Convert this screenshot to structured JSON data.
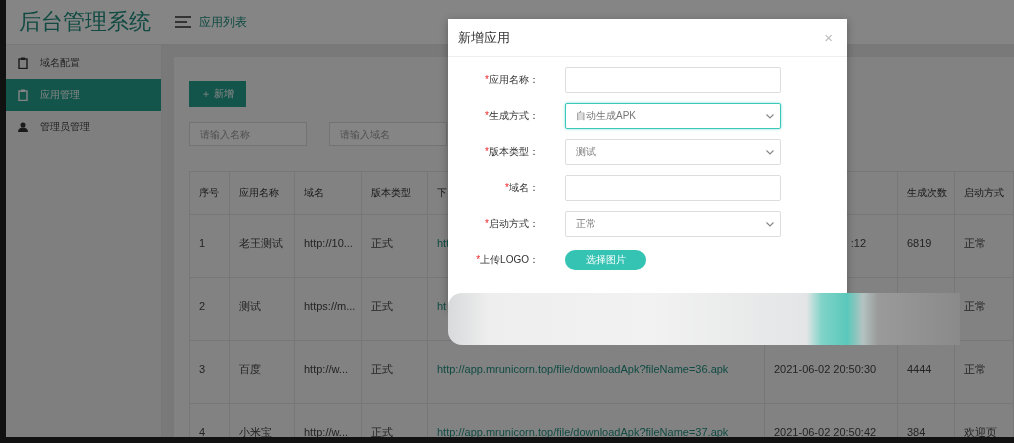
{
  "app_title": "后台管理系统",
  "breadcrumb": "应用列表",
  "sidebar": {
    "items": [
      {
        "label": "域名配置",
        "selected": false
      },
      {
        "label": "应用管理",
        "selected": true
      },
      {
        "label": "管理员管理",
        "selected": false
      }
    ]
  },
  "toolbar": {
    "add_button": "＋ 新增",
    "filters": [
      {
        "placeholder": "请输入名称"
      },
      {
        "placeholder": "请输入域名"
      }
    ]
  },
  "table": {
    "columns": [
      "序号",
      "应用名称",
      "域名",
      "版本类型",
      "下",
      null,
      "生成次数",
      "启动方式"
    ],
    "rows": [
      [
        "1",
        "老王测试",
        "http://10...",
        "正式",
        "htt",
        ":12",
        "6819",
        "正常"
      ],
      [
        "2",
        "测试",
        "https://m...",
        "正式",
        "ht",
        null,
        null,
        "正常"
      ],
      [
        "3",
        "百度",
        "http://w...",
        "正式",
        "http://app.mrunicorn.top/file/downloadApk?fileName=36.apk",
        "2021-06-02 20:50:30",
        "4444",
        "正常"
      ],
      [
        "4",
        "小米宝",
        "http://w...",
        "正式",
        "http://app.mrunicorn.top/file/downloadApk?fileName=37.apk",
        "2021-06-02 20:50:42",
        "384",
        "欢迎页"
      ]
    ]
  },
  "dialog": {
    "title": "新增应用",
    "close": "×",
    "required_mark": "*",
    "fields": [
      {
        "kind": "input",
        "label": "应用名称：",
        "required": true,
        "focused": false
      },
      {
        "kind": "select",
        "label": "生成方式：",
        "required": true,
        "value": "自动生成APK",
        "focused": true
      },
      {
        "kind": "select",
        "label": "版本类型：",
        "required": true,
        "value": "测试",
        "focused": false
      },
      {
        "kind": "input",
        "label": "域名：",
        "required": true,
        "focused": false
      },
      {
        "kind": "select",
        "label": "启动方式：",
        "required": true,
        "value": "正常",
        "focused": false
      },
      {
        "kind": "upload",
        "label": "上传LOGO：",
        "required": true,
        "button": "选择图片"
      }
    ]
  }
}
